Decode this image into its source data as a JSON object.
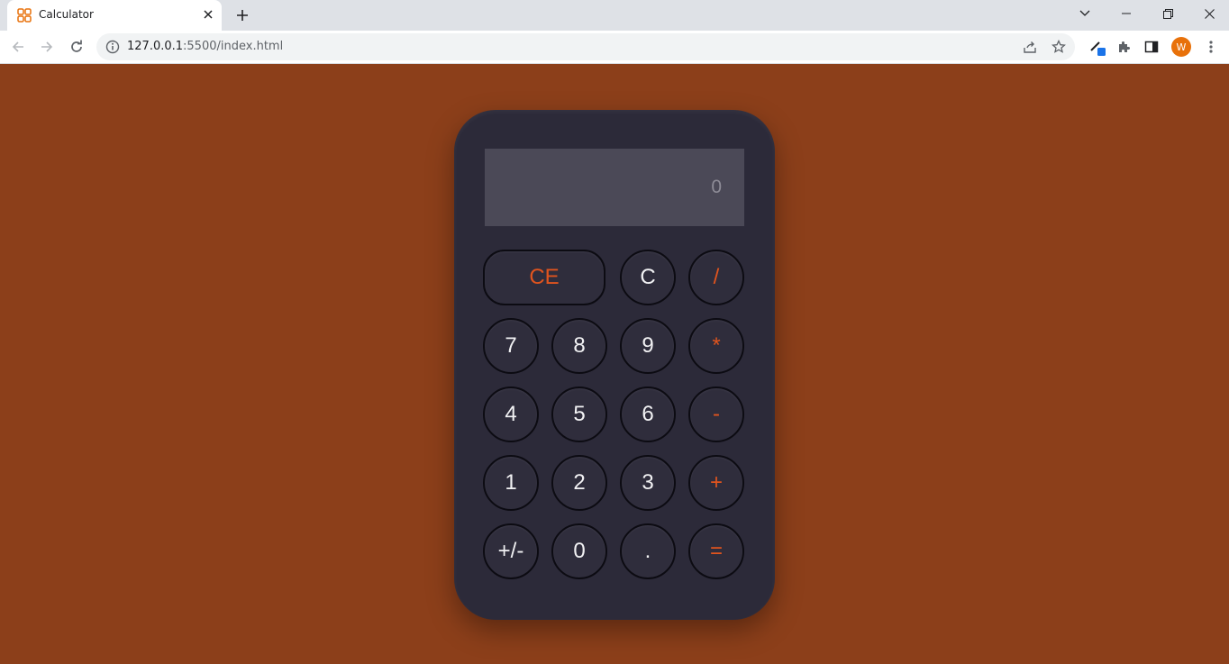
{
  "browser": {
    "tab_title": "Calculator",
    "url_host": "127.0.0.1",
    "url_rest": ":5500/index.html",
    "avatar_letter": "W"
  },
  "calculator": {
    "display": "0",
    "keys": {
      "ce": "CE",
      "c": "C",
      "divide": "/",
      "seven": "7",
      "eight": "8",
      "nine": "9",
      "multiply": "*",
      "four": "4",
      "five": "5",
      "six": "6",
      "minus": "-",
      "one": "1",
      "two": "2",
      "three": "3",
      "plus": "+",
      "negate": "+/-",
      "zero": "0",
      "decimal": ".",
      "equals": "="
    }
  },
  "colors": {
    "page_background": "#8c3f1a",
    "calculator_body": "#2c2a39",
    "display_background": "#4b4957",
    "operator_accent": "#e0541e"
  }
}
